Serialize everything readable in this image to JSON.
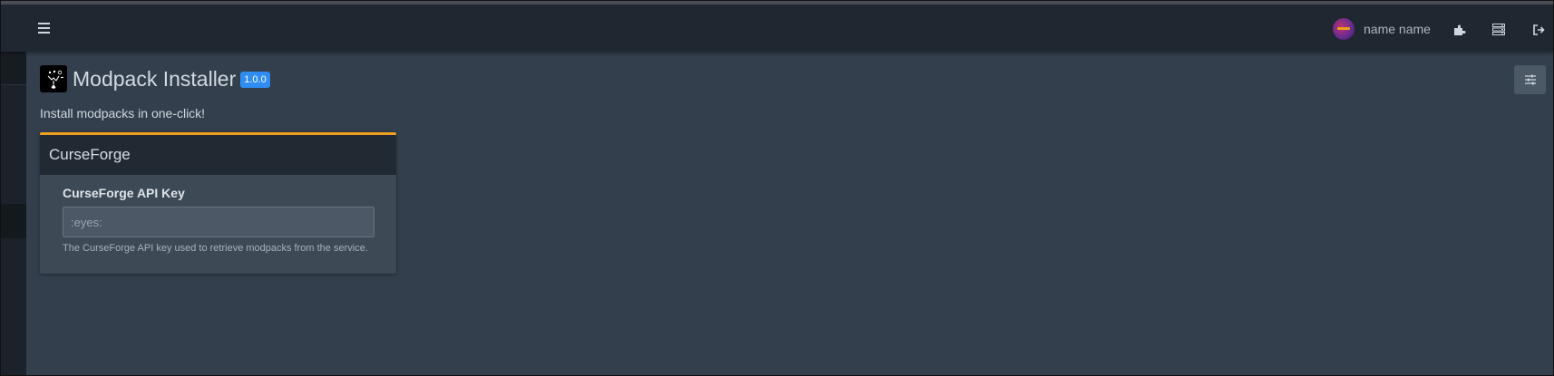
{
  "navbar": {
    "user": {
      "name": "name name"
    },
    "icons": [
      "menu-icon",
      "puzzle-icon",
      "server-icon",
      "logout-icon"
    ]
  },
  "page": {
    "title": "Modpack Installer",
    "version": "1.0.0",
    "description": "Install modpacks in one-click!"
  },
  "card": {
    "title": "CurseForge",
    "field": {
      "label": "CurseForge API Key",
      "placeholder": ":eyes:",
      "value": "",
      "help": "The CurseForge API key used to retrieve modpacks from the service."
    }
  },
  "colors": {
    "accent": "#f0a020",
    "badge": "#2f8cf0",
    "background": "#333f4c",
    "navbar": "#1f2730"
  }
}
